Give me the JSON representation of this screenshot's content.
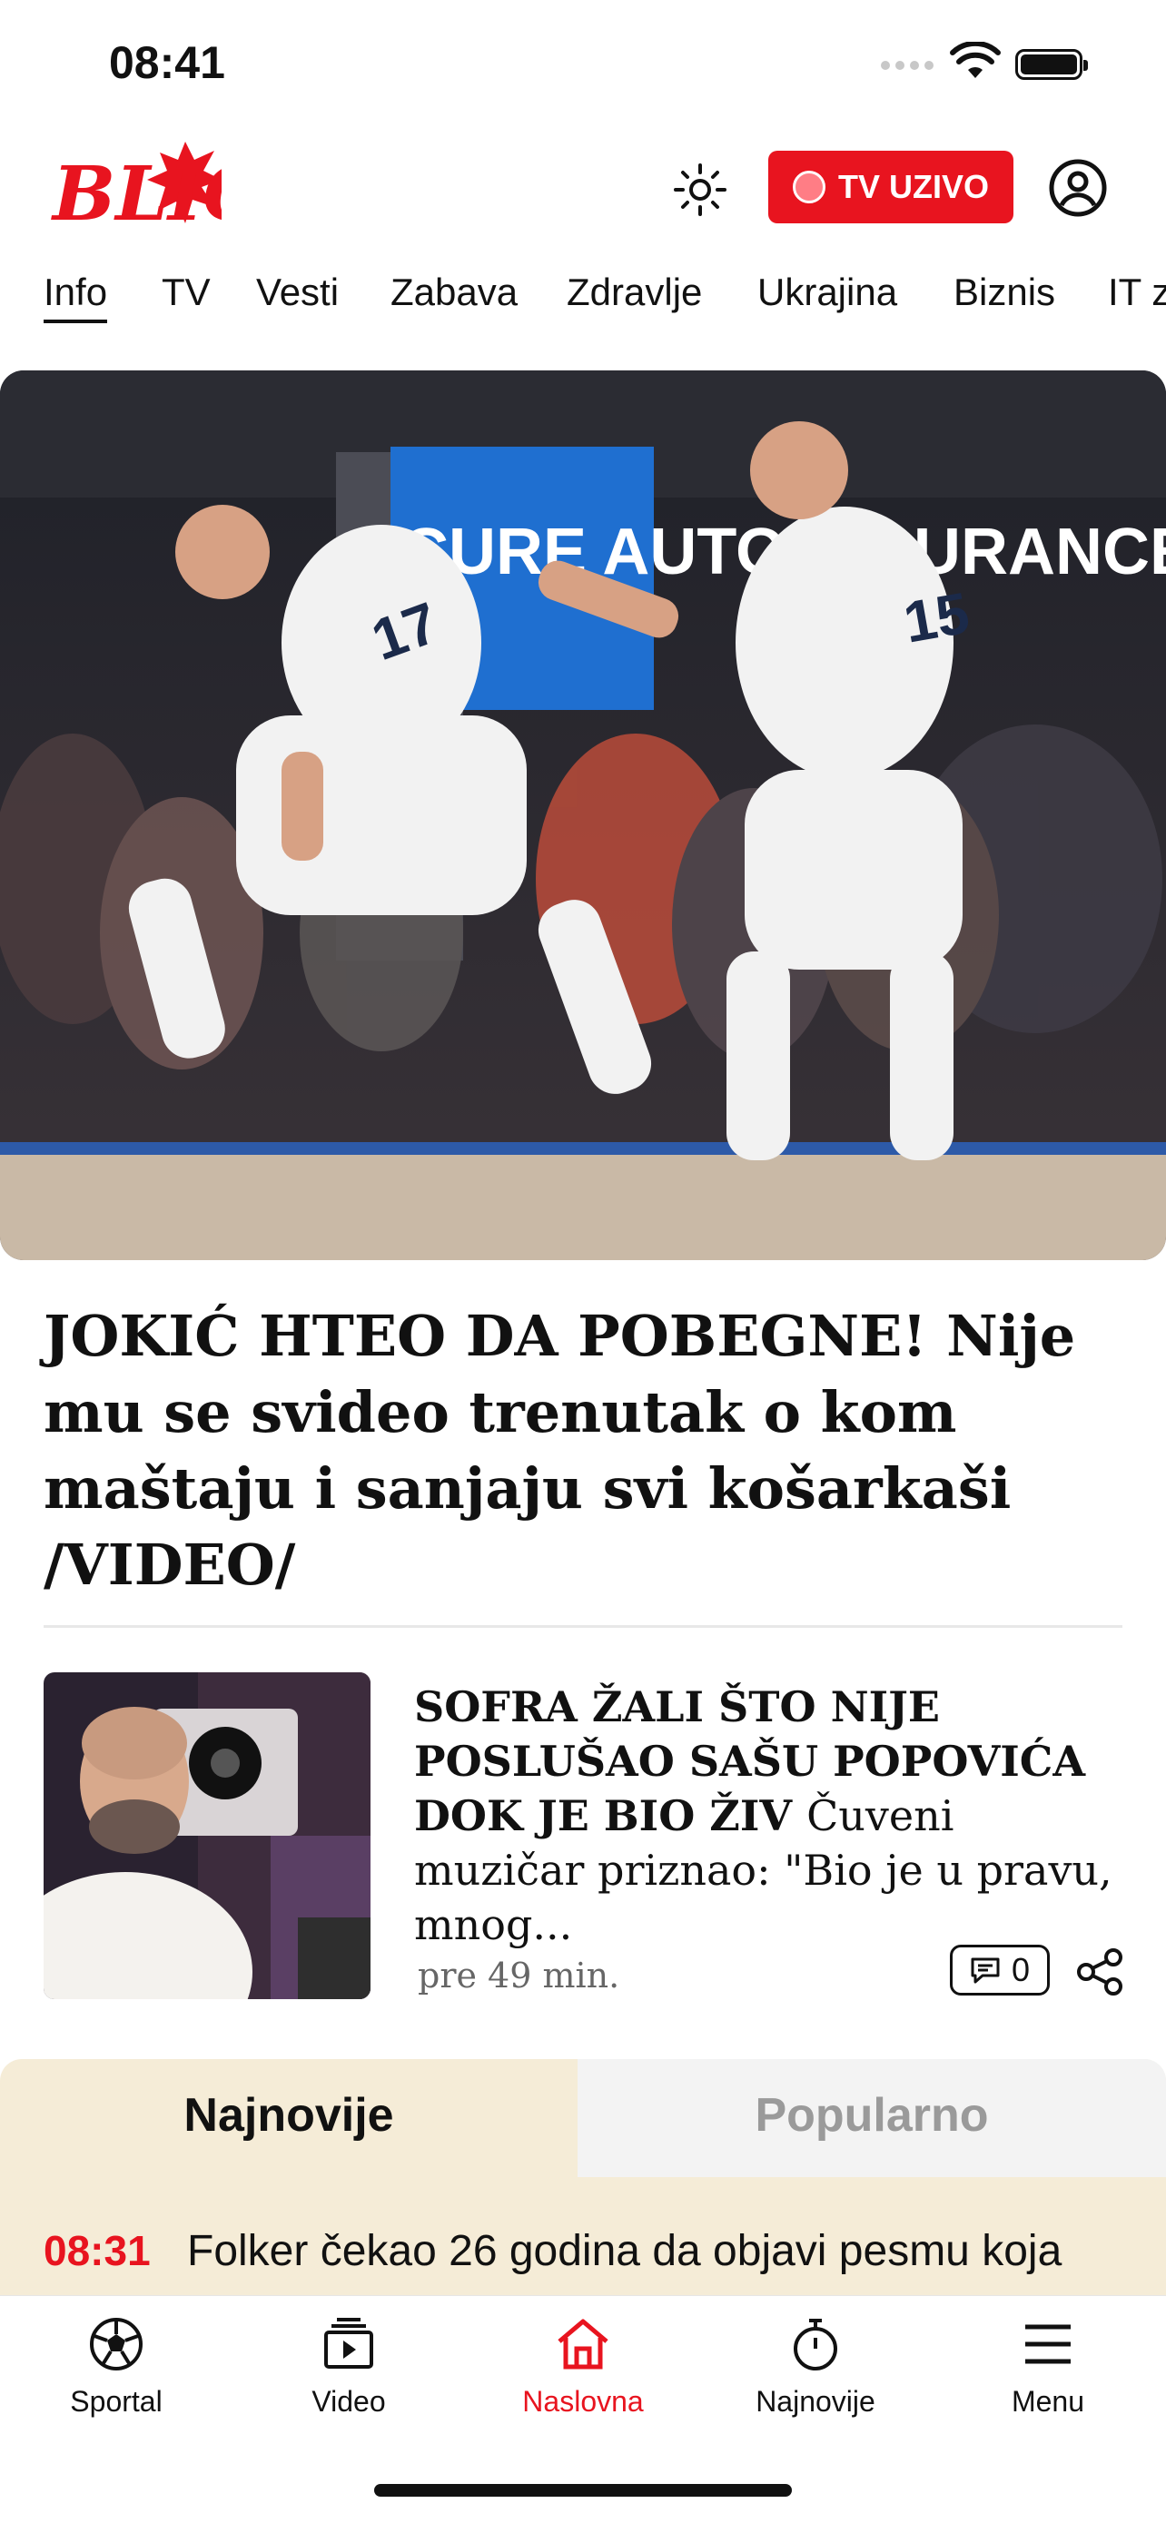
{
  "status_bar": {
    "time": "08:41"
  },
  "header": {
    "logo_text": "BLIC",
    "tv_button": "TV UZIVO"
  },
  "nav": {
    "items": [
      "Info",
      "TV",
      "Vesti",
      "Zabava",
      "Zdravlje",
      "Ukrajina",
      "Biznis",
      "IT z"
    ],
    "active": "Info"
  },
  "hero": {
    "title": "JOKIĆ HTEO DA POBEGNE! Nije mu se svideo trenutak o kom maštaju i sanjaju svi košarkaši /VIDEO/",
    "photo_text": "CURE AUTO INSURANCE"
  },
  "article": {
    "title_bold": "SOFRA ŽALI ŠTO NIJE POSLUŠAO SAŠU POPOVIĆA DOK JE BIO ŽIV",
    "title_rest": "Čuveni muzičar priznao: \"Bio je u pravu, mnog...",
    "time": "pre 49 min.",
    "comments": "0"
  },
  "feed_tabs": {
    "newest": "Najnovije",
    "popular": "Popularno",
    "active": "newest"
  },
  "latest": {
    "time": "08:31",
    "text": "Folker čekao 26 godina da objavi pesmu koja"
  },
  "tabbar": {
    "items": [
      {
        "label": "Sportal",
        "icon": "soccer-ball-icon"
      },
      {
        "label": "Video",
        "icon": "video-icon"
      },
      {
        "label": "Naslovna",
        "icon": "home-icon"
      },
      {
        "label": "Najnovije",
        "icon": "stopwatch-icon"
      },
      {
        "label": "Menu",
        "icon": "menu-icon"
      }
    ],
    "active": "Naslovna"
  },
  "colors": {
    "brand_red": "#e8141f",
    "tab_bg": "#f5ecd7"
  }
}
